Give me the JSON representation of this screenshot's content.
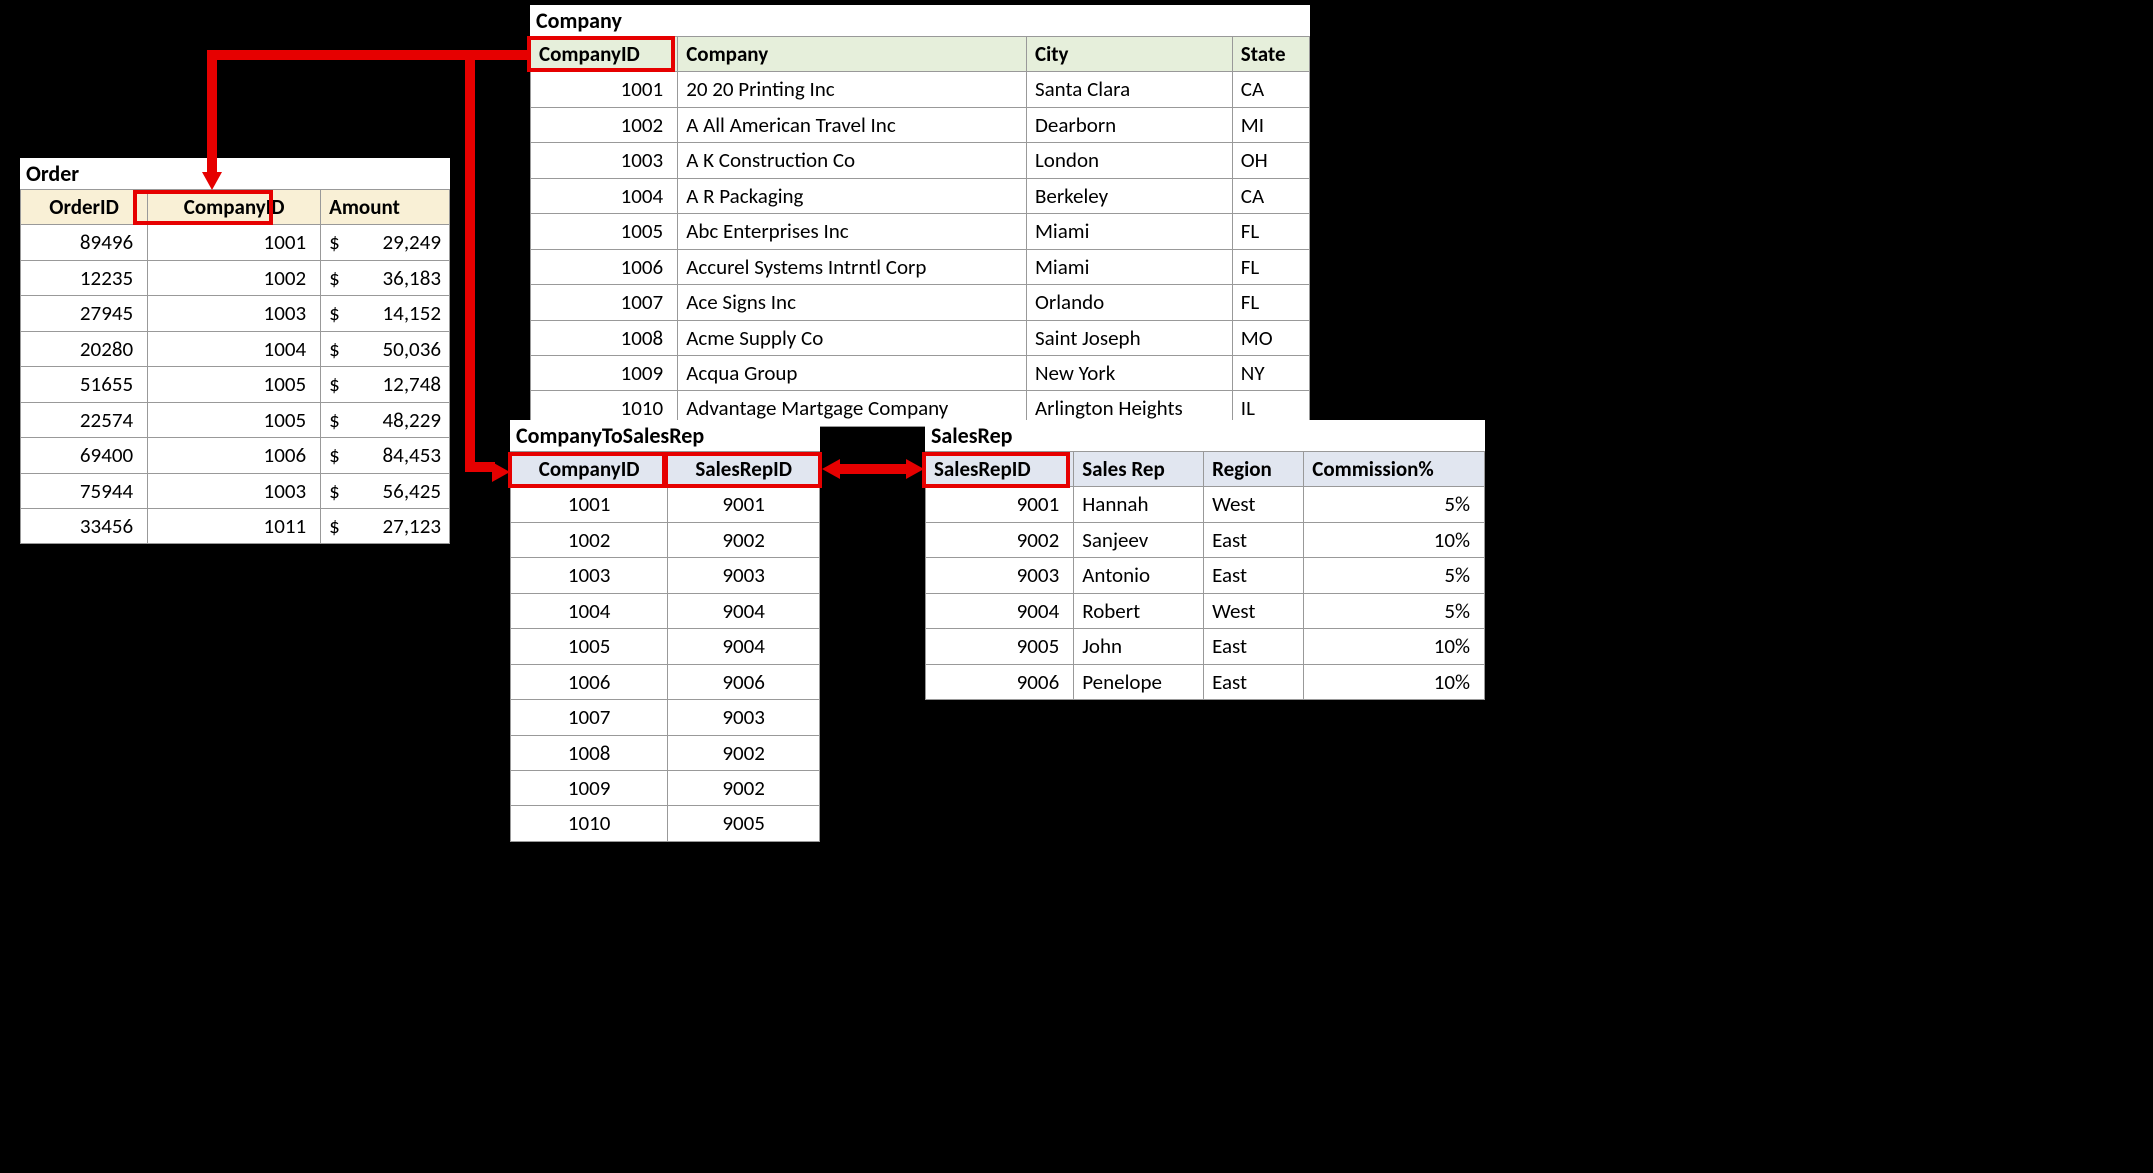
{
  "order": {
    "title": "Order",
    "headers": [
      "OrderID",
      "CompanyID",
      "Amount"
    ],
    "rows": [
      {
        "orderId": "89496",
        "companyId": "1001",
        "amount": "29,249"
      },
      {
        "orderId": "12235",
        "companyId": "1002",
        "amount": "36,183"
      },
      {
        "orderId": "27945",
        "companyId": "1003",
        "amount": "14,152"
      },
      {
        "orderId": "20280",
        "companyId": "1004",
        "amount": "50,036"
      },
      {
        "orderId": "51655",
        "companyId": "1005",
        "amount": "12,748"
      },
      {
        "orderId": "22574",
        "companyId": "1005",
        "amount": "48,229"
      },
      {
        "orderId": "69400",
        "companyId": "1006",
        "amount": "84,453"
      },
      {
        "orderId": "75944",
        "companyId": "1003",
        "amount": "56,425"
      },
      {
        "orderId": "33456",
        "companyId": "1011",
        "amount": "27,123"
      }
    ]
  },
  "company": {
    "title": "Company",
    "headers": [
      "CompanyID",
      "Company",
      "City",
      "State"
    ],
    "rows": [
      {
        "id": "1001",
        "name": "20 20 Printing Inc",
        "city": "Santa Clara",
        "state": "CA"
      },
      {
        "id": "1002",
        "name": "A All American Travel Inc",
        "city": "Dearborn",
        "state": "MI"
      },
      {
        "id": "1003",
        "name": "A K Construction Co",
        "city": "London",
        "state": "OH"
      },
      {
        "id": "1004",
        "name": "A R Packaging",
        "city": "Berkeley",
        "state": "CA"
      },
      {
        "id": "1005",
        "name": "Abc Enterprises Inc",
        "city": "Miami",
        "state": "FL"
      },
      {
        "id": "1006",
        "name": "Accurel Systems Intrntl Corp",
        "city": "Miami",
        "state": "FL"
      },
      {
        "id": "1007",
        "name": "Ace Signs Inc",
        "city": "Orlando",
        "state": "FL"
      },
      {
        "id": "1008",
        "name": "Acme Supply Co",
        "city": "Saint Joseph",
        "state": "MO"
      },
      {
        "id": "1009",
        "name": "Acqua Group",
        "city": "New York",
        "state": "NY"
      },
      {
        "id": "1010",
        "name": "Advantage Martgage Company",
        "city": "Arlington Heights",
        "state": "IL"
      }
    ]
  },
  "c2s": {
    "title": "CompanyToSalesRep",
    "headers": [
      "CompanyID",
      "SalesRepID"
    ],
    "rows": [
      {
        "companyId": "1001",
        "salesRepId": "9001"
      },
      {
        "companyId": "1002",
        "salesRepId": "9002"
      },
      {
        "companyId": "1003",
        "salesRepId": "9003"
      },
      {
        "companyId": "1004",
        "salesRepId": "9004"
      },
      {
        "companyId": "1005",
        "salesRepId": "9004"
      },
      {
        "companyId": "1006",
        "salesRepId": "9006"
      },
      {
        "companyId": "1007",
        "salesRepId": "9003"
      },
      {
        "companyId": "1008",
        "salesRepId": "9002"
      },
      {
        "companyId": "1009",
        "salesRepId": "9002"
      },
      {
        "companyId": "1010",
        "salesRepId": "9005"
      }
    ]
  },
  "salesrep": {
    "title": "SalesRep",
    "headers": [
      "SalesRepID",
      "Sales Rep",
      "Region",
      "Commission%"
    ],
    "rows": [
      {
        "id": "9001",
        "name": "Hannah",
        "region": "West",
        "pct": "5%"
      },
      {
        "id": "9002",
        "name": "Sanjeev",
        "region": "East",
        "pct": "10%"
      },
      {
        "id": "9003",
        "name": "Antonio",
        "region": "East",
        "pct": "5%"
      },
      {
        "id": "9004",
        "name": "Robert",
        "region": "West",
        "pct": "5%"
      },
      {
        "id": "9005",
        "name": "John",
        "region": "East",
        "pct": "10%"
      },
      {
        "id": "9006",
        "name": "Penelope",
        "region": "East",
        "pct": "10%"
      }
    ]
  },
  "currency": "$"
}
